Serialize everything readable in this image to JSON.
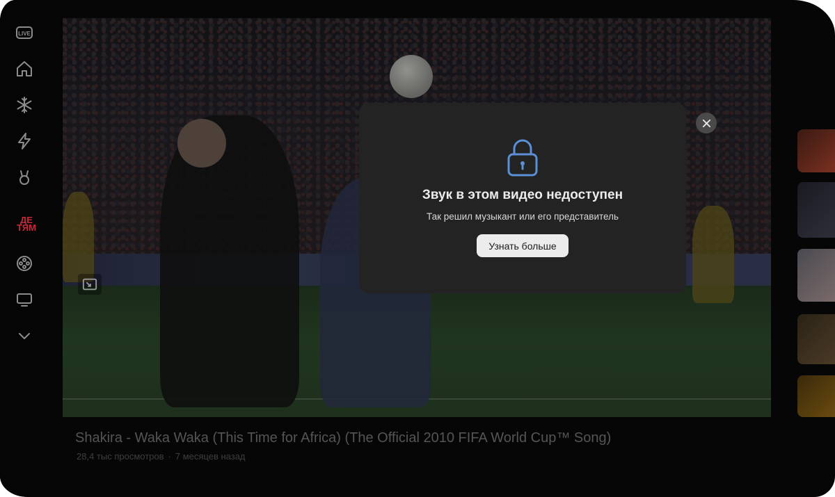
{
  "sidebar": {
    "live_label": "LIVE",
    "items": [
      {
        "icon": "home-icon"
      },
      {
        "icon": "snowflake-icon"
      },
      {
        "icon": "lightning-icon"
      },
      {
        "icon": "bunny-icon"
      },
      {
        "icon": "kids-logo",
        "label": "ДЕ ТЯМ"
      },
      {
        "icon": "film-reel-icon"
      },
      {
        "icon": "tv-icon"
      },
      {
        "icon": "chevron-down-icon"
      }
    ]
  },
  "dialog": {
    "title": "Звук в этом видео недоступен",
    "subtitle": "Так решил музыкант или его представитель",
    "button_label": "Узнать больше",
    "accent_color": "#5b8fd6"
  },
  "video": {
    "title": "Shakira - Waka Waka (This Time for Africa) (The Official 2010 FIFA World Cup™ Song)",
    "views": "28,4 тыс просмотров",
    "separator": "·",
    "age": "7 месяцев назад"
  }
}
